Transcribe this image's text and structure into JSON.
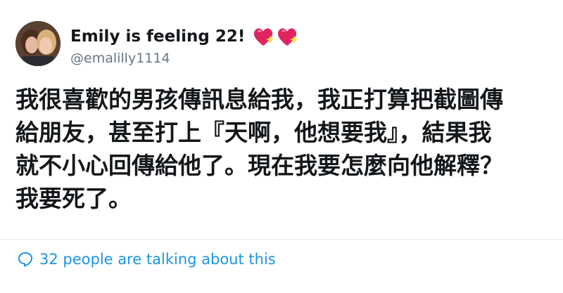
{
  "user": {
    "display_name": "Emily is feeling 22!",
    "handle": "@emalilly1114",
    "avatar_icon": "user-avatar-photo",
    "name_emoji": [
      "sparkling-heart-icon",
      "sparkling-heart-icon"
    ]
  },
  "tweet": {
    "lines": [
      "我很喜歡的男孩傳訊息給我，我正打算把截圖傳",
      "給朋友，甚至打上『天啊，他想要我』，結果我",
      "就不小心回傳給他了。現在我要怎麼向他解釋？",
      "我要死了。"
    ]
  },
  "engagement": {
    "icon": "speech-bubble-icon",
    "text": "32 people are talking about this"
  },
  "colors": {
    "text_primary": "#14171a",
    "text_secondary": "#657786",
    "link_blue": "#1b95e0",
    "heart_pink": "#e0245e",
    "divider": "#e6ecf0"
  }
}
